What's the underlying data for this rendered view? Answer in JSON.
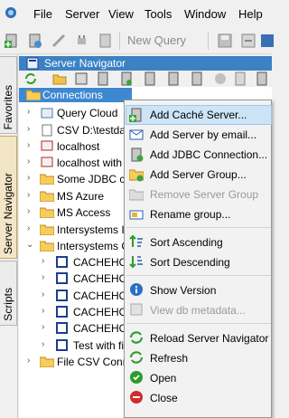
{
  "menubar": {
    "items": [
      {
        "label": "File"
      },
      {
        "label": "Server"
      },
      {
        "label": "View"
      },
      {
        "label": "Tools"
      },
      {
        "label": "Window"
      },
      {
        "label": "Help"
      }
    ]
  },
  "toolbar": {
    "new_query": "New Query"
  },
  "side_tabs": {
    "favorites": "Favorites",
    "server_navigator": "Server Navigator",
    "scripts": "Scripts"
  },
  "panel": {
    "title": "Server Navigator"
  },
  "tree": {
    "root": "Connections",
    "items": [
      {
        "label": "Query Cloud"
      },
      {
        "label": "CSV D:\\testdata"
      },
      {
        "label": "localhost"
      },
      {
        "label": "localhost with"
      },
      {
        "label": "Some JDBC co"
      },
      {
        "label": "MS Azure"
      },
      {
        "label": "MS Access"
      },
      {
        "label": "Intersystems II"
      },
      {
        "label": "Intersystems C"
      },
      {
        "label": "CACHEHO"
      },
      {
        "label": "CACHEHO"
      },
      {
        "label": "CACHEHO"
      },
      {
        "label": "CACHEHO"
      },
      {
        "label": "CACHEHO"
      },
      {
        "label": "Test with fi"
      },
      {
        "label": "File CSV Conn"
      }
    ]
  },
  "context_menu": {
    "items": [
      {
        "label": "Add Caché Server...",
        "icon": "add-server-icon"
      },
      {
        "label": "Add Server by email...",
        "icon": "email-server-icon"
      },
      {
        "label": "Add JDBC Connection...",
        "icon": "add-jdbc-icon"
      },
      {
        "label": "Add Server Group...",
        "icon": "add-group-icon"
      },
      {
        "label": "Remove Server Group",
        "icon": "remove-group-icon",
        "disabled": true
      },
      {
        "label": "Rename group...",
        "icon": "rename-icon"
      },
      {
        "label": "Sort Ascending",
        "icon": "sort-ascending-icon"
      },
      {
        "label": "Sort Descending",
        "icon": "sort-descending-icon"
      },
      {
        "label": "Show Version",
        "icon": "info-icon"
      },
      {
        "label": "View db metadata...",
        "icon": "metadata-icon",
        "disabled": true
      },
      {
        "label": "Reload Server Navigator",
        "icon": "reload-icon"
      },
      {
        "label": "Refresh",
        "icon": "refresh-icon"
      },
      {
        "label": "Open",
        "icon": "open-icon"
      },
      {
        "label": "Close",
        "icon": "close-icon"
      }
    ]
  },
  "colors": {
    "accent": "#3b82c4",
    "selection": "#3e88d0",
    "menu_highlight": "#cde4f7"
  }
}
